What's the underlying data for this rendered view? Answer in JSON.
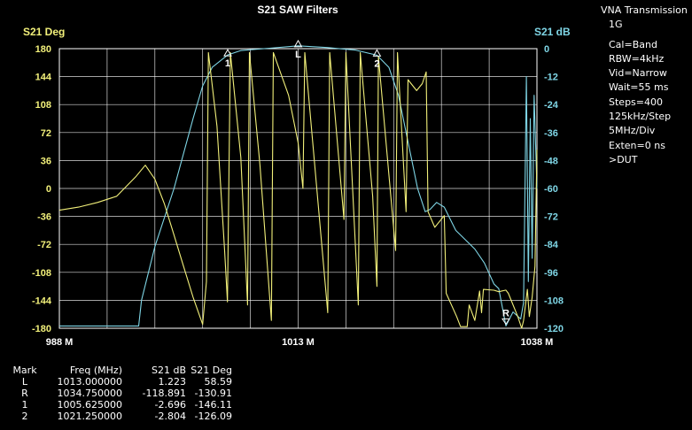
{
  "panel": {
    "title": "VNA Transmission",
    "band": "1G",
    "settings": [
      "Cal=Band",
      "RBW=4kHz",
      "Vid=Narrow",
      "Wait=55 ms",
      "Steps=400",
      "125kHz/Step",
      "5MHz/Div",
      "Exten=0 ns",
      ">DUT"
    ]
  },
  "markers_table": {
    "headers": [
      "Mark",
      "Freq (MHz)",
      "S21 dB",
      "S21 Deg"
    ],
    "rows": [
      [
        "L",
        "1013.000000",
        "1.223",
        "58.59"
      ],
      [
        "R",
        "1034.750000",
        "-118.891",
        "-130.91"
      ],
      [
        "1",
        "1005.625000",
        "-2.696",
        "-146.11"
      ],
      [
        "2",
        "1021.250000",
        "-2.804",
        "-126.09"
      ]
    ]
  },
  "colors": {
    "degree_trace": "#f2f07a",
    "db_trace": "#7fd6e6",
    "axis_left": "#f2f07a",
    "axis_right": "#7fd6e6",
    "grid": "#ffffff"
  },
  "chart_data": {
    "type": "line",
    "title": "S21 SAW Filters",
    "xlabel": "",
    "x_ticks": [
      "988 M",
      "1013 M",
      "1038 M"
    ],
    "xlim": [
      988,
      1038
    ],
    "grid": true,
    "y_left": {
      "label": "S21 Deg",
      "lim": [
        -180,
        180
      ],
      "ticks": [
        180,
        144,
        108,
        72,
        36,
        0,
        -36,
        -72,
        -108,
        -144,
        -180
      ]
    },
    "y_right": {
      "label": "S21 dB",
      "lim": [
        -120,
        0
      ],
      "ticks": [
        0,
        -12,
        -24,
        -36,
        -48,
        -60,
        -72,
        -84,
        -96,
        -108,
        -120
      ]
    },
    "series": [
      {
        "name": "S21 dB",
        "axis": "right",
        "x": [
          988,
          996.3,
          996.6,
          998,
          1000,
          1002,
          1003,
          1004,
          1005.625,
          1007,
          1010,
          1013,
          1016,
          1019,
          1021.25,
          1022.5,
          1023.5,
          1024.5,
          1025.5,
          1026.3,
          1026.8,
          1027.5,
          1028.3,
          1029.5,
          1030.5,
          1031.5,
          1032.5,
          1033.5,
          1034,
          1034.75,
          1035.5,
          1036.3,
          1036.6,
          1036.9,
          1037.1,
          1037.3,
          1037.5,
          1037.7,
          1038
        ],
        "y": [
          -119,
          -119,
          -108,
          -85,
          -60,
          -30,
          -16,
          -8,
          -2.7,
          -0.8,
          0.2,
          1.2,
          0.5,
          -0.6,
          -2.8,
          -8,
          -20,
          -40,
          -60,
          -70,
          -69,
          -66,
          -68,
          -78,
          -82,
          -86,
          -92,
          -101,
          -103,
          -119,
          -113,
          -116,
          -109,
          -12,
          -100,
          -30,
          -90,
          -20,
          -60
        ]
      },
      {
        "name": "S21 Deg",
        "axis": "left",
        "x": [
          988,
          990,
          992,
          994,
          996,
          997,
          998,
          999,
          1000,
          1001,
          1002,
          1003,
          1003.4,
          1003.6,
          1004.5,
          1005.3,
          1005.6,
          1005.9,
          1007,
          1007.7,
          1007.9,
          1009,
          1010.2,
          1010.4,
          1012,
          1013,
          1013.5,
          1013.7,
          1016.1,
          1016.3,
          1017.8,
          1018,
          1019.3,
          1019.5,
          1020.8,
          1021.25,
          1021.4,
          1023.2,
          1023.4,
          1024.3,
          1024.5,
          1025.4,
          1026,
          1026.4,
          1026.6,
          1027.3,
          1028.3,
          1028.5,
          1029.6,
          1030,
          1030.7,
          1030.9,
          1031.5,
          1032,
          1032.2,
          1032.4,
          1033.5,
          1034,
          1034.75,
          1035,
          1036,
          1036.4,
          1036.6,
          1037,
          1037.2,
          1037.5,
          1037.8,
          1038
        ],
        "y": [
          -28,
          -24,
          -18,
          -10,
          15,
          30,
          12,
          -20,
          -60,
          -100,
          -140,
          -175,
          -120,
          175,
          80,
          -80,
          -146,
          175,
          40,
          -150,
          175,
          30,
          -170,
          175,
          120,
          58.6,
          0,
          175,
          -160,
          175,
          -40,
          175,
          -150,
          175,
          -10,
          -126.1,
          170,
          -80,
          175,
          -30,
          140,
          126,
          135,
          150,
          -30,
          -50,
          -35,
          -135,
          -165,
          -178,
          -178,
          -150,
          -170,
          -132,
          -160,
          -130,
          -131,
          -133,
          -130.9,
          -135,
          -165,
          -180,
          -170,
          -130,
          -165,
          -140,
          -100,
          50
        ]
      }
    ],
    "markers": [
      {
        "label": "1",
        "x": 1005.625
      },
      {
        "label": "L",
        "x": 1013
      },
      {
        "label": "2",
        "x": 1021.25
      },
      {
        "label": "R",
        "x": 1034.75
      }
    ]
  }
}
